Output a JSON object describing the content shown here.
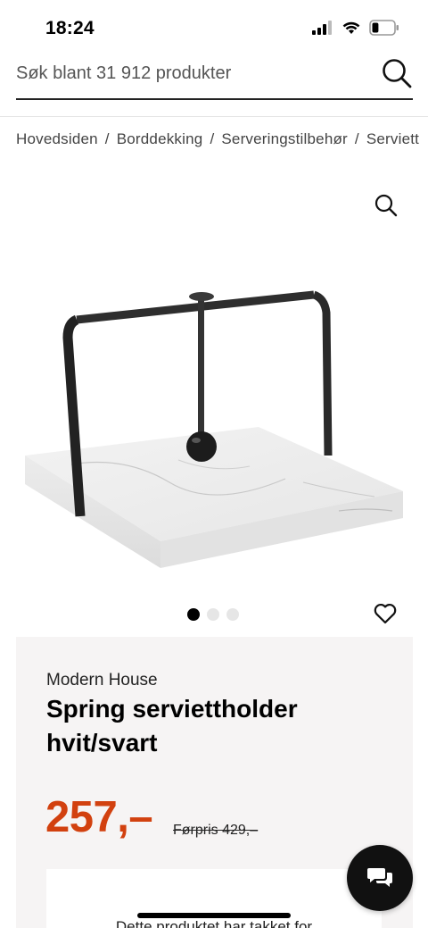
{
  "status_bar": {
    "time": "18:24",
    "battery_level": 0.3
  },
  "search": {
    "placeholder": "Søk blant 31 912 produkter"
  },
  "breadcrumb": [
    "Hovedsiden",
    "Borddekking",
    "Serveringstilbehør",
    "Serviett"
  ],
  "gallery": {
    "total_images": 3,
    "active_index": 0
  },
  "product": {
    "brand": "Modern House",
    "title": "Spring serviettholder hvit/svart",
    "price": "257,–",
    "previous_price": "Førpris 429,–",
    "notice_partial": "Dette produktet har takket for"
  },
  "colors": {
    "price": "#d2410f",
    "card_bg": "#f6f4f4"
  },
  "icons": {
    "search": "search-icon",
    "zoom": "magnifier-icon",
    "favorite": "heart-icon",
    "chat": "chat-icon"
  }
}
